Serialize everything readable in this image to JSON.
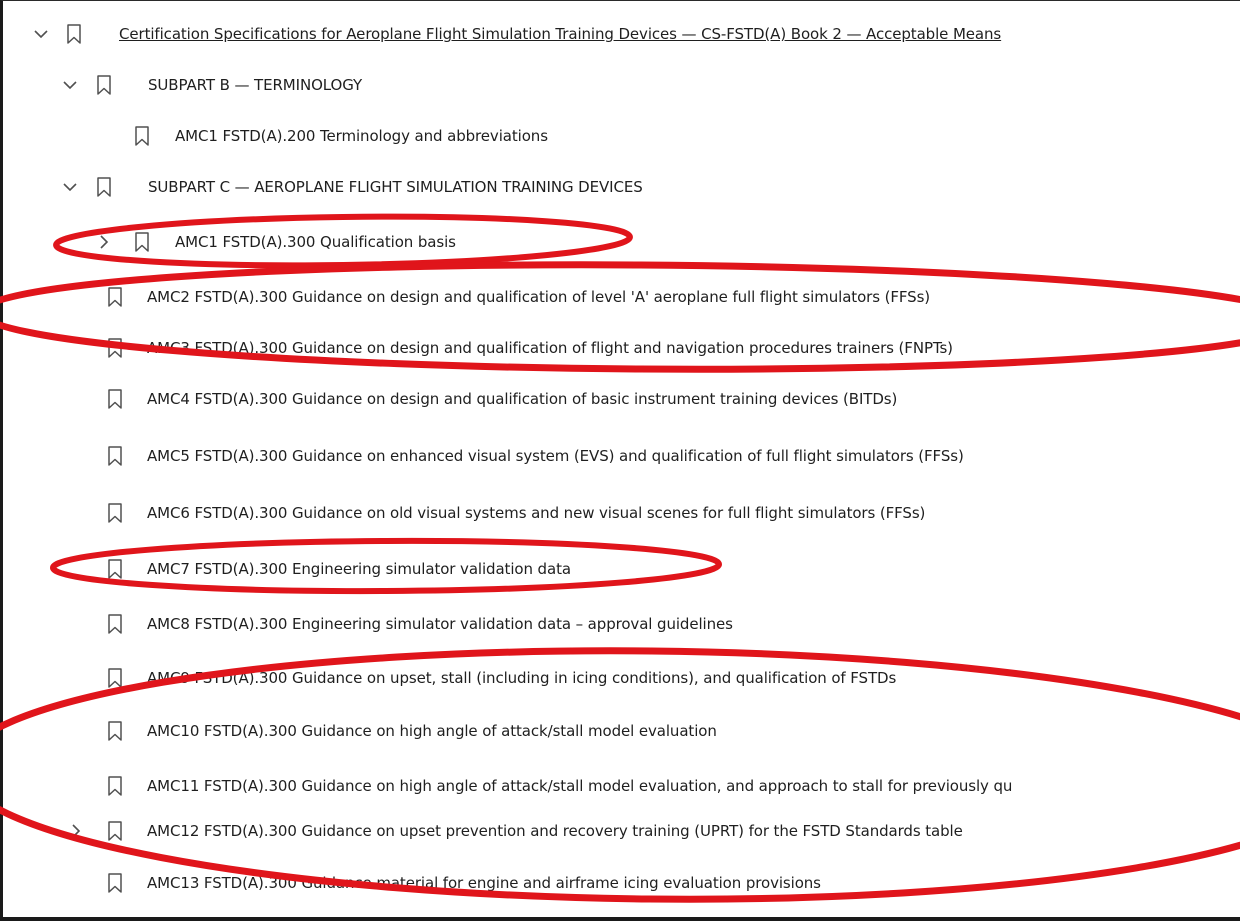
{
  "bookmarks": {
    "root": {
      "label": "Certification Specifications for Aeroplane Flight Simulation Training Devices — CS-FSTD(A) Book 2 — Acceptable Means",
      "expanded": true
    },
    "subpart_b": {
      "label": "SUBPART B — TERMINOLOGY",
      "expanded": true
    },
    "amc1_200": {
      "label": "AMC1 FSTD(A).200 Terminology and abbreviations"
    },
    "subpart_c": {
      "label": "SUBPART C — AEROPLANE FLIGHT SIMULATION TRAINING DEVICES",
      "expanded": true
    },
    "items": [
      {
        "label": "AMC1 FSTD(A).300 Qualification basis",
        "has_children": true
      },
      {
        "label": "AMC2 FSTD(A).300 Guidance on design and qualification of level 'A' aeroplane full flight simulators (FFSs)"
      },
      {
        "label": "AMC3 FSTD(A).300 Guidance on design and qualification of flight and navigation procedures trainers (FNPTs)"
      },
      {
        "label": "AMC4 FSTD(A).300 Guidance on design and qualification of basic instrument training devices (BITDs)"
      },
      {
        "label": "AMC5 FSTD(A).300 Guidance on enhanced visual system (EVS) and qualification of full flight simulators (FFSs)"
      },
      {
        "label": "AMC6 FSTD(A).300 Guidance on old visual systems and new visual scenes for full flight simulators (FFSs)"
      },
      {
        "label": "AMC7 FSTD(A).300 Engineering simulator validation data"
      },
      {
        "label": "AMC8 FSTD(A).300 Engineering simulator validation data – approval guidelines"
      },
      {
        "label": "AMC9 FSTD(A).300 Guidance on upset, stall (including in icing conditions), and qualification of FSTDs"
      },
      {
        "label": "AMC10 FSTD(A).300 Guidance on high angle of attack/stall model evaluation"
      },
      {
        "label": "AMC11 FSTD(A).300 Guidance on high angle of attack/stall model evaluation, and approach to stall for previously qu"
      },
      {
        "label": "AMC12 FSTD(A).300 Guidance on upset prevention and recovery training (UPRT) for the FSTD Standards table",
        "has_children": true
      },
      {
        "label": "AMC13 FSTD(A).300 Guidance material for engine and airframe icing evaluation provisions"
      }
    ]
  },
  "annotation_color": "#e0151b",
  "icon_color": "#505050"
}
